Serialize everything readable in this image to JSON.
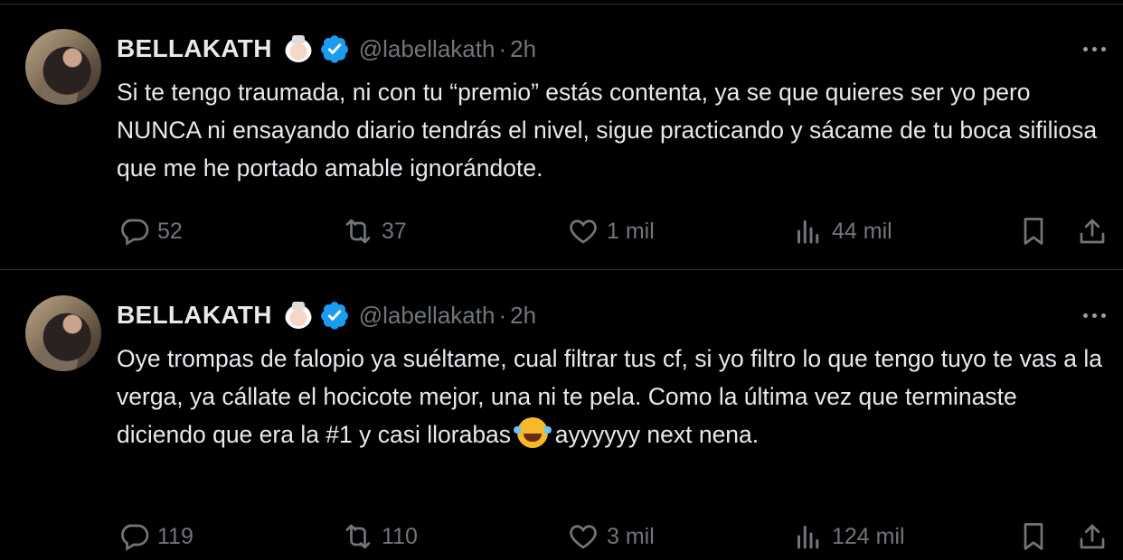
{
  "tweets": [
    {
      "author_name": "BELLAKATH",
      "handle": "@labellakath",
      "separator": "·",
      "time": "2h",
      "text": "Si te tengo traumada, ni con tu “premio” estás contenta, ya se que quieres ser yo pero NUNCA ni ensayando diario tendrás el nivel, sigue practicando y sácame de tu boca sifiliosa que me he portado amable ignorándote.",
      "replies": "52",
      "reposts": "37",
      "likes": "1 mil",
      "views": "44 mil"
    },
    {
      "author_name": "BELLAKATH",
      "handle": "@labellakath",
      "separator": "·",
      "time": "2h",
      "text_before_emoji": "Oye trompas de falopio ya suéltame, cual filtrar tus cf, si yo filtro lo que tengo tuyo te vas a la verga, ya cállate el hocicote mejor, una ni te pela. Como la última vez que terminaste diciendo que era la #1 y casi llorabas ",
      "text_after_emoji": " ayyyyyy next nena.",
      "emoji": "face-with-tears-of-joy",
      "replies": "119",
      "reposts": "110",
      "likes": "3 mil",
      "views": "124 mil"
    }
  ],
  "colors": {
    "background": "#000000",
    "text": "#e7e9ea",
    "muted": "#71767b",
    "verified": "#1d9bf0",
    "divider": "#2f3336"
  },
  "icons": [
    "reply-icon",
    "repost-icon",
    "like-icon",
    "views-icon",
    "bookmark-icon",
    "share-icon",
    "more-icon",
    "verified-badge-icon"
  ]
}
